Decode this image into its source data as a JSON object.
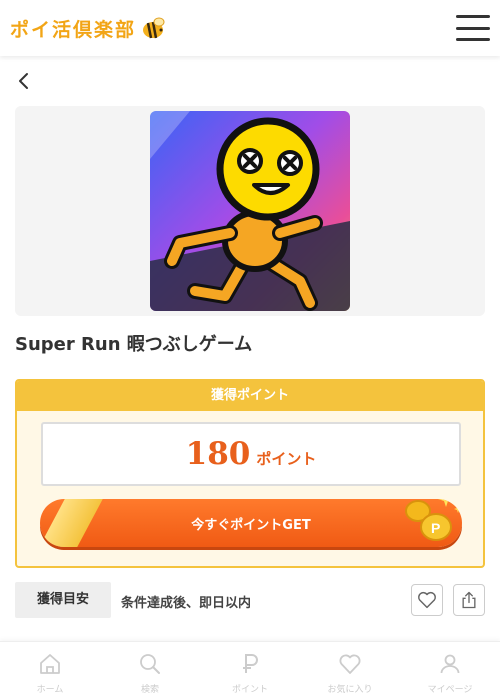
{
  "header": {
    "logo_text": "ポイ活倶楽部",
    "logo_icon": "bee-icon",
    "menu_icon": "hamburger-menu-icon"
  },
  "back": {
    "icon": "chevron-left-icon"
  },
  "app": {
    "title": "Super Run 暇つぶしゲーム",
    "icon": "running-yellow-character-icon"
  },
  "points": {
    "header": "獲得ポイント",
    "value": "180",
    "unit": "ポイント",
    "cta_label": "今すぐポイントGET",
    "cta_icon": "coins-icon"
  },
  "condition": {
    "label": "獲得目安",
    "text": "条件達成後、即日以内"
  },
  "actions": {
    "favorite_icon": "heart-icon",
    "share_icon": "share-icon"
  },
  "nav": {
    "items": [
      {
        "label": "ホーム",
        "icon": "home-icon"
      },
      {
        "label": "検索",
        "icon": "search-icon"
      },
      {
        "label": "ポイント",
        "icon": "point-icon"
      },
      {
        "label": "お気に入り",
        "icon": "heart-icon"
      },
      {
        "label": "マイページ",
        "icon": "user-icon"
      }
    ]
  },
  "colors": {
    "brand": "#f2a516",
    "accent_orange": "#f05a14",
    "card_yellow": "#f4c33d",
    "nav_inactive": "#cccccc"
  }
}
